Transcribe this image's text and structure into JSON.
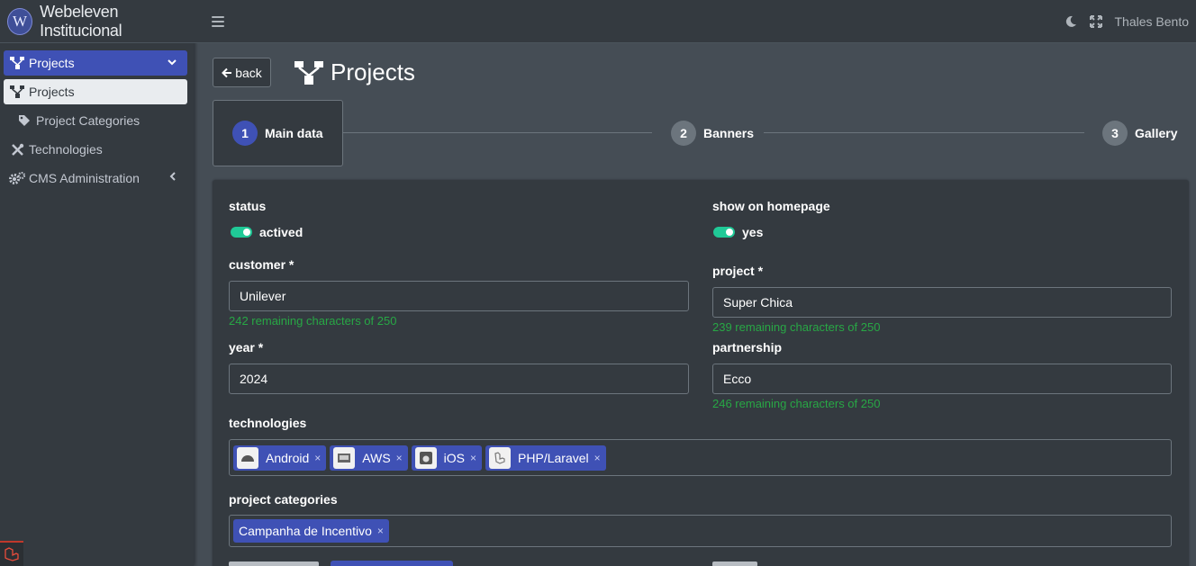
{
  "brand": {
    "logo_letter": "W",
    "name": "Webeleven Institucional"
  },
  "sidebar": {
    "items": [
      {
        "label": "Projects",
        "icon": "sitemap-icon"
      },
      {
        "label": "Projects",
        "icon": "sitemap-icon"
      },
      {
        "label": "Project Categories",
        "icon": "tag-icon"
      },
      {
        "label": "Technologies",
        "icon": "tools-icon"
      },
      {
        "label": "CMS Administration",
        "icon": "cogs-icon"
      }
    ]
  },
  "topbar": {
    "user": "Thales Bento"
  },
  "page": {
    "back_label": "back",
    "title": "Projects"
  },
  "stepper": {
    "steps": [
      {
        "number": "1",
        "label": "Main data"
      },
      {
        "number": "2",
        "label": "Banners"
      },
      {
        "number": "3",
        "label": "Gallery"
      }
    ]
  },
  "form": {
    "status": {
      "label": "status",
      "value": "actived"
    },
    "show_on_homepage": {
      "label": "show on homepage",
      "value": "yes"
    },
    "customer": {
      "label": "customer *",
      "value": "Unilever",
      "hint": "242 remaining characters of 250"
    },
    "project": {
      "label": "project *",
      "value": "Super Chica",
      "hint": "239 remaining characters of 250"
    },
    "year": {
      "label": "year *",
      "value": "2024"
    },
    "partnership": {
      "label": "partnership",
      "value": "Ecco",
      "hint": "246 remaining characters of 250"
    },
    "technologies": {
      "label": "technologies",
      "tags": [
        {
          "label": "Android",
          "icon": "android-icon"
        },
        {
          "label": "AWS",
          "icon": "aws-icon"
        },
        {
          "label": "iOS",
          "icon": "apple-icon"
        },
        {
          "label": "PHP/Laravel",
          "icon": "laravel-icon"
        }
      ],
      "remove_glyph": "×"
    },
    "project_categories": {
      "label": "project categories",
      "tags": [
        {
          "label": "Campanha de Incentivo"
        }
      ]
    }
  },
  "colors": {
    "accent": "#3f51b5",
    "toggle_on": "#20c997",
    "hint": "#28a745",
    "sidebar_bg": "#343a40",
    "content_bg": "#454d55"
  }
}
